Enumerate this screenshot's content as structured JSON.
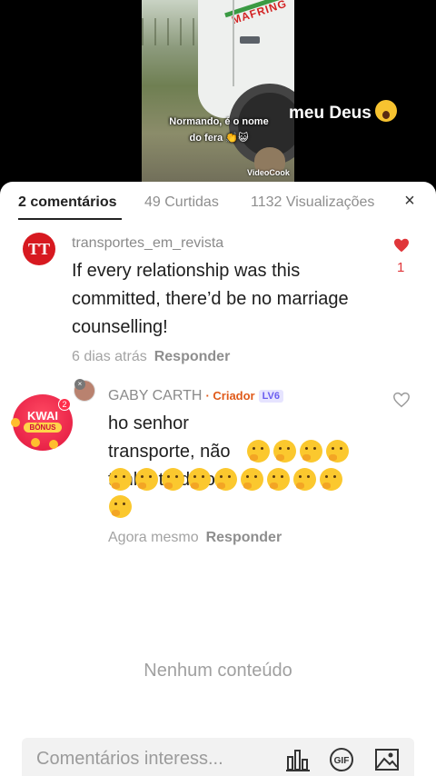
{
  "video": {
    "truck_brand": "MAFRING",
    "caption_small": "Normando, é o nome do fera 👏😺",
    "watermark": "VideoCook",
    "caption_big": "meu Deus"
  },
  "tabs": {
    "comments": "2 comentários",
    "likes": "49 Curtidas",
    "views": "1132 Visualizações",
    "close": "×"
  },
  "comments": [
    {
      "username": "transportes_em_revista",
      "avatar_text": "TT",
      "text": "If every relationship was this committed, there’d be no marriage counselling!",
      "time": "6 dias atrás",
      "reply": "Responder",
      "likes": "1"
    },
    {
      "username": "GABY CARTH",
      "creator": "· Criador",
      "level": "LV6",
      "text": "ho senhor transporte, não tenho tradutor",
      "time": "Agora mesmo",
      "reply": "Responder",
      "avatar_badge": "×"
    }
  ],
  "kwai": {
    "title": "KWAI",
    "sub": "BÔNUS",
    "badge": "2"
  },
  "empty_text": "Nenhum conteúdo",
  "input": {
    "placeholder": "Comentários interess..."
  },
  "icons": {
    "like": "heart-icon",
    "chart": "bar-chart-icon",
    "gif": "gif-icon",
    "image": "image-icon",
    "emoji": "thinking-face-icon",
    "scream": "scream-face-icon"
  },
  "colors": {
    "accent_red": "#e0363a",
    "creator_orange": "#e05a1a",
    "level_purple": "#6a5df0"
  }
}
